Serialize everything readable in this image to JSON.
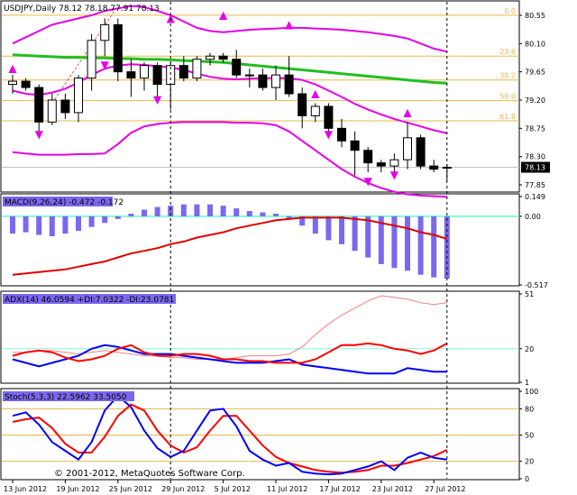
{
  "header": {
    "title": "USDJPY,Daily  78.12 78.18 77.91 78.13"
  },
  "colors": {
    "fib": "#e6b84a",
    "bb": "#e600e6",
    "ma": "#21bf21",
    "macd": "#7b68ee",
    "signal": "#e00000",
    "level": "#7fffd4",
    "adx": "#f08080",
    "dip": "#0000ff",
    "dim": "#ff0000",
    "stochMain": "#0000ff",
    "stochSignal": "#ff0000",
    "arrow": "#e600e6"
  },
  "chart_data": [
    {
      "type": "candlestick",
      "title": "USDJPY,Daily  78.12 78.18 77.91 78.13",
      "ylim": [
        77.75,
        80.75
      ],
      "y_ticks": [
        "80.55",
        "80.10",
        "79.65",
        "79.20",
        "78.75",
        "78.30",
        "77.85"
      ],
      "current_price": "78.13",
      "fib_levels": [
        {
          "label": "0.0",
          "price": 80.55
        },
        {
          "label": "23.6",
          "price": 79.9
        },
        {
          "label": "38.2",
          "price": 79.52
        },
        {
          "label": "50.0",
          "price": 79.19
        },
        {
          "label": "61.8",
          "price": 78.87
        }
      ],
      "candles": [
        {
          "o": 79.45,
          "h": 79.6,
          "l": 79.3,
          "c": 79.5
        },
        {
          "o": 79.5,
          "h": 79.55,
          "l": 79.35,
          "c": 79.4
        },
        {
          "o": 79.4,
          "h": 79.45,
          "l": 78.7,
          "c": 78.85
        },
        {
          "o": 78.85,
          "h": 79.3,
          "l": 78.8,
          "c": 79.2
        },
        {
          "o": 79.2,
          "h": 79.3,
          "l": 78.9,
          "c": 79.0
        },
        {
          "o": 79.0,
          "h": 79.6,
          "l": 78.85,
          "c": 79.55
        },
        {
          "o": 79.55,
          "h": 80.25,
          "l": 79.35,
          "c": 80.15
        },
        {
          "o": 80.15,
          "h": 80.5,
          "l": 79.9,
          "c": 80.4
        },
        {
          "o": 80.4,
          "h": 80.5,
          "l": 79.5,
          "c": 79.65
        },
        {
          "o": 79.65,
          "h": 79.85,
          "l": 79.25,
          "c": 79.55
        },
        {
          "o": 79.55,
          "h": 79.8,
          "l": 79.35,
          "c": 79.75
        },
        {
          "o": 79.75,
          "h": 79.8,
          "l": 79.25,
          "c": 79.45
        },
        {
          "o": 79.45,
          "h": 79.8,
          "l": 79.05,
          "c": 79.75
        },
        {
          "o": 79.75,
          "h": 79.9,
          "l": 79.5,
          "c": 79.55
        },
        {
          "o": 79.55,
          "h": 79.9,
          "l": 79.5,
          "c": 79.85
        },
        {
          "o": 79.85,
          "h": 79.95,
          "l": 79.75,
          "c": 79.9
        },
        {
          "o": 79.9,
          "h": 79.95,
          "l": 79.8,
          "c": 79.85
        },
        {
          "o": 79.85,
          "h": 80.0,
          "l": 79.55,
          "c": 79.6
        },
        {
          "o": 79.6,
          "h": 79.7,
          "l": 79.4,
          "c": 79.6
        },
        {
          "o": 79.6,
          "h": 79.7,
          "l": 79.35,
          "c": 79.4
        },
        {
          "o": 79.4,
          "h": 79.75,
          "l": 79.2,
          "c": 79.6
        },
        {
          "o": 79.6,
          "h": 79.9,
          "l": 79.25,
          "c": 79.3
        },
        {
          "o": 79.3,
          "h": 79.4,
          "l": 78.75,
          "c": 78.95
        },
        {
          "o": 78.95,
          "h": 79.15,
          "l": 78.85,
          "c": 79.1
        },
        {
          "o": 79.1,
          "h": 79.15,
          "l": 78.7,
          "c": 78.75
        },
        {
          "o": 78.75,
          "h": 78.9,
          "l": 78.45,
          "c": 78.55
        },
        {
          "o": 78.55,
          "h": 78.7,
          "l": 78.0,
          "c": 78.4
        },
        {
          "o": 78.4,
          "h": 78.45,
          "l": 78.05,
          "c": 78.2
        },
        {
          "o": 78.2,
          "h": 78.25,
          "l": 78.05,
          "c": 78.15
        },
        {
          "o": 78.15,
          "h": 78.35,
          "l": 78.05,
          "c": 78.25
        },
        {
          "o": 78.25,
          "h": 78.85,
          "l": 78.1,
          "c": 78.6
        },
        {
          "o": 78.6,
          "h": 78.65,
          "l": 78.1,
          "c": 78.15
        },
        {
          "o": 78.15,
          "h": 78.25,
          "l": 78.05,
          "c": 78.1
        },
        {
          "o": 78.12,
          "h": 78.18,
          "l": 77.91,
          "c": 78.13
        }
      ],
      "moving_average": [
        79.92,
        79.91,
        79.9,
        79.89,
        79.88,
        79.88,
        79.87,
        79.87,
        79.86,
        79.86,
        79.85,
        79.85,
        79.84,
        79.83,
        79.82,
        79.81,
        79.8,
        79.78,
        79.76,
        79.74,
        79.72,
        79.7,
        79.68,
        79.66,
        79.64,
        79.62,
        79.6,
        79.58,
        79.56,
        79.54,
        79.52,
        79.5,
        79.48,
        79.47
      ],
      "bb_upper": [
        80.1,
        80.2,
        80.3,
        80.4,
        80.45,
        80.5,
        80.55,
        80.62,
        80.66,
        80.7,
        80.68,
        80.62,
        80.55,
        80.45,
        80.35,
        80.3,
        80.28,
        80.3,
        80.32,
        80.33,
        80.34,
        80.35,
        80.35,
        80.34,
        80.33,
        80.32,
        80.3,
        80.28,
        80.25,
        80.22,
        80.18,
        80.1,
        80.02,
        79.97
      ],
      "bb_middle": [
        79.35,
        79.3,
        79.28,
        79.32,
        79.38,
        79.48,
        79.6,
        79.7,
        79.75,
        79.77,
        79.76,
        79.74,
        79.72,
        79.68,
        79.62,
        79.57,
        79.54,
        79.53,
        79.54,
        79.55,
        79.55,
        79.55,
        79.52,
        79.45,
        79.35,
        79.25,
        79.14,
        79.05,
        78.97,
        78.9,
        78.84,
        78.78,
        78.72,
        78.67
      ],
      "bb_lower": [
        78.37,
        78.35,
        78.33,
        78.33,
        78.33,
        78.34,
        78.34,
        78.35,
        78.5,
        78.68,
        78.78,
        78.82,
        78.84,
        78.85,
        78.85,
        78.85,
        78.85,
        78.84,
        78.84,
        78.83,
        78.8,
        78.7,
        78.55,
        78.4,
        78.25,
        78.1,
        77.98,
        77.88,
        77.8,
        77.74,
        77.7,
        77.68,
        77.67,
        77.66
      ],
      "arrows_up": [
        {
          "i": 0,
          "price": 79.65
        },
        {
          "i": 12,
          "price": 80.45
        },
        {
          "i": 16,
          "price": 80.5
        },
        {
          "i": 21,
          "price": 80.35
        },
        {
          "i": 23,
          "price": 79.25
        },
        {
          "i": 30,
          "price": 78.95
        }
      ],
      "arrows_down": [
        {
          "i": 2,
          "price": 78.6
        },
        {
          "i": 7,
          "price": 79.7
        },
        {
          "i": 11,
          "price": 79.15
        },
        {
          "i": 24,
          "price": 78.6
        },
        {
          "i": 27,
          "price": 77.85
        },
        {
          "i": 29,
          "price": 77.95
        }
      ]
    },
    {
      "type": "bar",
      "title": "MACD(9,26,24) -0.472 -0.172",
      "ylim": [
        -0.517,
        0.149
      ],
      "y_ticks": [
        "0.149",
        "0.00",
        "-0.517"
      ],
      "values": [
        -0.13,
        -0.12,
        -0.14,
        -0.15,
        -0.13,
        -0.11,
        -0.08,
        -0.05,
        -0.02,
        0.02,
        0.05,
        0.07,
        0.08,
        0.09,
        0.09,
        0.09,
        0.08,
        0.06,
        0.04,
        0.03,
        0.02,
        -0.02,
        -0.07,
        -0.13,
        -0.18,
        -0.21,
        -0.26,
        -0.31,
        -0.36,
        -0.39,
        -0.41,
        -0.44,
        -0.46,
        -0.47
      ],
      "signal": [
        -0.44,
        -0.43,
        -0.42,
        -0.41,
        -0.4,
        -0.38,
        -0.36,
        -0.34,
        -0.31,
        -0.28,
        -0.26,
        -0.24,
        -0.21,
        -0.19,
        -0.16,
        -0.14,
        -0.12,
        -0.09,
        -0.07,
        -0.05,
        -0.03,
        -0.02,
        -0.01,
        -0.01,
        -0.01,
        -0.01,
        -0.02,
        -0.03,
        -0.05,
        -0.07,
        -0.09,
        -0.12,
        -0.14,
        -0.17
      ]
    },
    {
      "type": "line",
      "title": "ADX(14) 46.0594 +DI:7.0322 -DI:23.0781",
      "ylim": [
        1,
        51
      ],
      "y_ticks": [
        "51",
        "20",
        "1"
      ],
      "series": [
        {
          "name": "ADX",
          "values": [
            18,
            18,
            19,
            19,
            18,
            17,
            18,
            19,
            18,
            17,
            16,
            16,
            15,
            15,
            14,
            14,
            14,
            15,
            16,
            16,
            16,
            17,
            21,
            28,
            34,
            39,
            43,
            47,
            50,
            49,
            48,
            46,
            45,
            46
          ]
        },
        {
          "name": "+DI",
          "values": [
            14,
            12,
            10,
            12,
            14,
            16,
            20,
            22,
            21,
            19,
            17,
            17,
            17,
            16,
            15,
            14,
            13,
            12,
            12,
            12,
            13,
            14,
            11,
            10,
            9,
            8,
            7,
            6,
            6,
            6,
            9,
            8,
            7,
            7
          ]
        },
        {
          "name": "-DI",
          "values": [
            16,
            18,
            19,
            18,
            15,
            13,
            14,
            16,
            20,
            22,
            18,
            16,
            16,
            17,
            17,
            16,
            14,
            14,
            13,
            13,
            12,
            12,
            12,
            14,
            18,
            22,
            22,
            23,
            22,
            20,
            19,
            17,
            19,
            23
          ]
        }
      ],
      "levels": [
        20
      ]
    },
    {
      "type": "line",
      "title": "Stoch(5,3,3) 22.5962 33.5050",
      "ylim": [
        0,
        100
      ],
      "y_ticks": [
        "100",
        "80",
        "50",
        "20",
        "0"
      ],
      "series": [
        {
          "name": "Main",
          "values": [
            72,
            76,
            62,
            42,
            32,
            22,
            42,
            78,
            95,
            82,
            55,
            35,
            25,
            32,
            55,
            78,
            80,
            60,
            32,
            22,
            15,
            18,
            8,
            6,
            5,
            6,
            10,
            14,
            20,
            10,
            24,
            30,
            24,
            22
          ]
        },
        {
          "name": "Signal",
          "values": [
            65,
            68,
            70,
            58,
            40,
            30,
            30,
            48,
            72,
            85,
            78,
            55,
            38,
            30,
            36,
            55,
            72,
            72,
            55,
            38,
            25,
            18,
            14,
            10,
            8,
            7,
            8,
            10,
            15,
            15,
            18,
            22,
            26,
            33
          ]
        }
      ],
      "levels": [
        80,
        50,
        20
      ]
    }
  ],
  "macd": {
    "label": "MACD(9,26,24) -0.472 -0.172"
  },
  "adx": {
    "label": "ADX(14) 46.0594 +DI:7.0322 -DI:23.0781"
  },
  "stoch": {
    "label": "Stoch(5,3,3) 22.5962 33.5050"
  },
  "dates": [
    {
      "label": "13 Jun 2012",
      "i": 0
    },
    {
      "label": "19 Jun 2012",
      "i": 4
    },
    {
      "label": "25 Jun 2012",
      "i": 8
    },
    {
      "label": "29 Jun 2012",
      "i": 12
    },
    {
      "label": "5 Jul 2012",
      "i": 16
    },
    {
      "label": "11 Jul 2012",
      "i": 20
    },
    {
      "label": "17 Jul 2012",
      "i": 24
    },
    {
      "label": "23 Jul 2012",
      "i": 28
    },
    {
      "label": "27 Jul 2012",
      "i": 32
    }
  ],
  "vlines": [
    12,
    33
  ],
  "copyright": "© 2001-2012, MetaQuotes Software Corp."
}
